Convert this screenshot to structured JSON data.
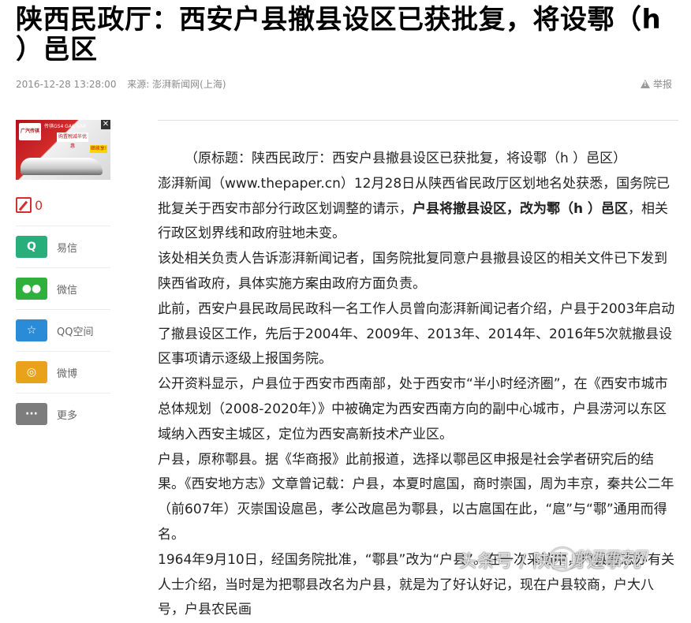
{
  "title": "陕西民政厅：西安户县撤县设区已获批复，将设鄠（h ）邑区",
  "meta": {
    "datetime": "2016-12-28 13:28:00",
    "source": "来源: 澎湃新闻网(上海)"
  },
  "report_label": "举报",
  "ad": {
    "brand": "广汽传祺",
    "headline": "传祺GS4 GA6 GA8",
    "badge": "购置税减半优惠",
    "cta": "继续享!",
    "close": "✕"
  },
  "comment": {
    "count": "0"
  },
  "share": [
    {
      "label": "易信",
      "icon": "yixin-icon",
      "glyph": "Q",
      "color": "#27ae7a"
    },
    {
      "label": "微信",
      "icon": "wechat-icon",
      "glyph": "●●",
      "color": "#2fb03c"
    },
    {
      "label": "QQ空间",
      "icon": "qzone-icon",
      "glyph": "☆",
      "color": "#2a8bd6"
    },
    {
      "label": "微博",
      "icon": "weibo-icon",
      "glyph": "◎",
      "color": "#e8a21b"
    },
    {
      "label": "更多",
      "icon": "more-icon",
      "glyph": "···",
      "color": "#7d7d7d"
    }
  ],
  "article": {
    "p1": "（原标题：陕西民政厅：西安户县撤县设区已获批复，将设鄠（h ）邑区）",
    "p2_a": "澎湃新闻（www.thepaper.cn）12月28日从陕西省民政厅区划地名处获悉，国务院已批复关于西安市部分行政区划调整的请示，",
    "p2_b": "户县将撤县设区，改为鄠（h ）邑区",
    "p2_c": "，相关行政区划界线和政府驻地未变。",
    "p3": "该处相关负责人告诉澎湃新闻记者，国务院批复同意户县撤县设区的相关文件已下发到陕西省政府，具体实施方案由政府方面负责。",
    "p4": "此前，西安户县民政局民政科一名工作人员曾向澎湃新闻记者介绍，户县于2003年启动了撤县设区工作，先后于2004年、2009年、2013年、2014年、2016年5次就撤县设区事项请示逐级上报国务院。",
    "p5": "公开资料显示，户县位于西安市西南部，处于西安市“半小时经济圈”，在《西安市城市总体规划（2008-2020年）》中被确定为西安西南方向的副中心城市，户县涝河以东区域纳入西安主城区，定位为西安高新技术产业区。",
    "p6": "户县，原称鄠县。据《华商报》此前报道，选择以鄠邑区申报是社会学者研究后的结果。《西安地方志》文章曾记载：户县，本夏时扈国，商时崇国，周为丰京，秦共公二年（前607年）灭崇国设扈邑，孝公改扈邑为鄠县，以古扈国在此，“扈”与“鄠”通用而得名。",
    "p7": "1964年9月10日，经国务院批准，“鄠县”改为“户县”。在一次采访中，户县方志办有关人士介绍，当时是为把鄠县改名为户县，就是为了好认好记，现在户县较商，户大八号，户县农民画"
  },
  "watermark": {
    "text": "头条号 / 陕西身边事儿",
    "name": "陕西西安网"
  }
}
